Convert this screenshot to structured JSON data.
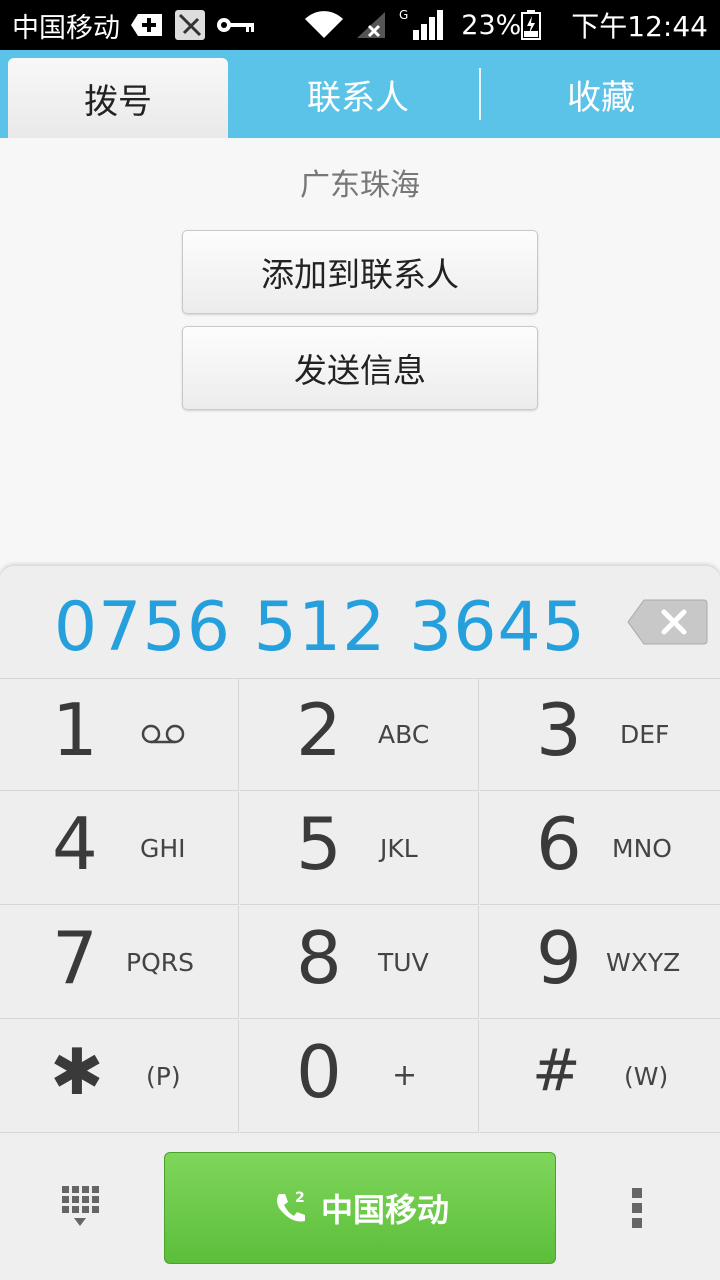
{
  "status_bar": {
    "carrier": "中国移动",
    "network": "G",
    "battery": "23%",
    "time": "下午12:44"
  },
  "tabs": [
    {
      "label": "拨号",
      "active": true
    },
    {
      "label": "联系人",
      "active": false
    },
    {
      "label": "收藏",
      "active": false
    }
  ],
  "content": {
    "location": "广东珠海",
    "add_contact_button": "添加到联系人",
    "send_message_button": "发送信息"
  },
  "dialpad": {
    "number": "0756 512 3645",
    "keys": [
      {
        "digit": "1",
        "letters": ""
      },
      {
        "digit": "2",
        "letters": "ABC"
      },
      {
        "digit": "3",
        "letters": "DEF"
      },
      {
        "digit": "4",
        "letters": "GHI"
      },
      {
        "digit": "5",
        "letters": "JKL"
      },
      {
        "digit": "6",
        "letters": "MNO"
      },
      {
        "digit": "7",
        "letters": "PQRS"
      },
      {
        "digit": "8",
        "letters": "TUV"
      },
      {
        "digit": "9",
        "letters": "WXYZ"
      },
      {
        "digit": "✱",
        "letters": "(P)"
      },
      {
        "digit": "0",
        "letters": "+"
      },
      {
        "digit": "#",
        "letters": "(W)"
      }
    ],
    "call_button_label": "中国移动",
    "call_sim": "2"
  },
  "colors": {
    "tab_bar": "#5bc3e8",
    "number": "#26a0dc",
    "call_button": "#6ccb4a"
  }
}
